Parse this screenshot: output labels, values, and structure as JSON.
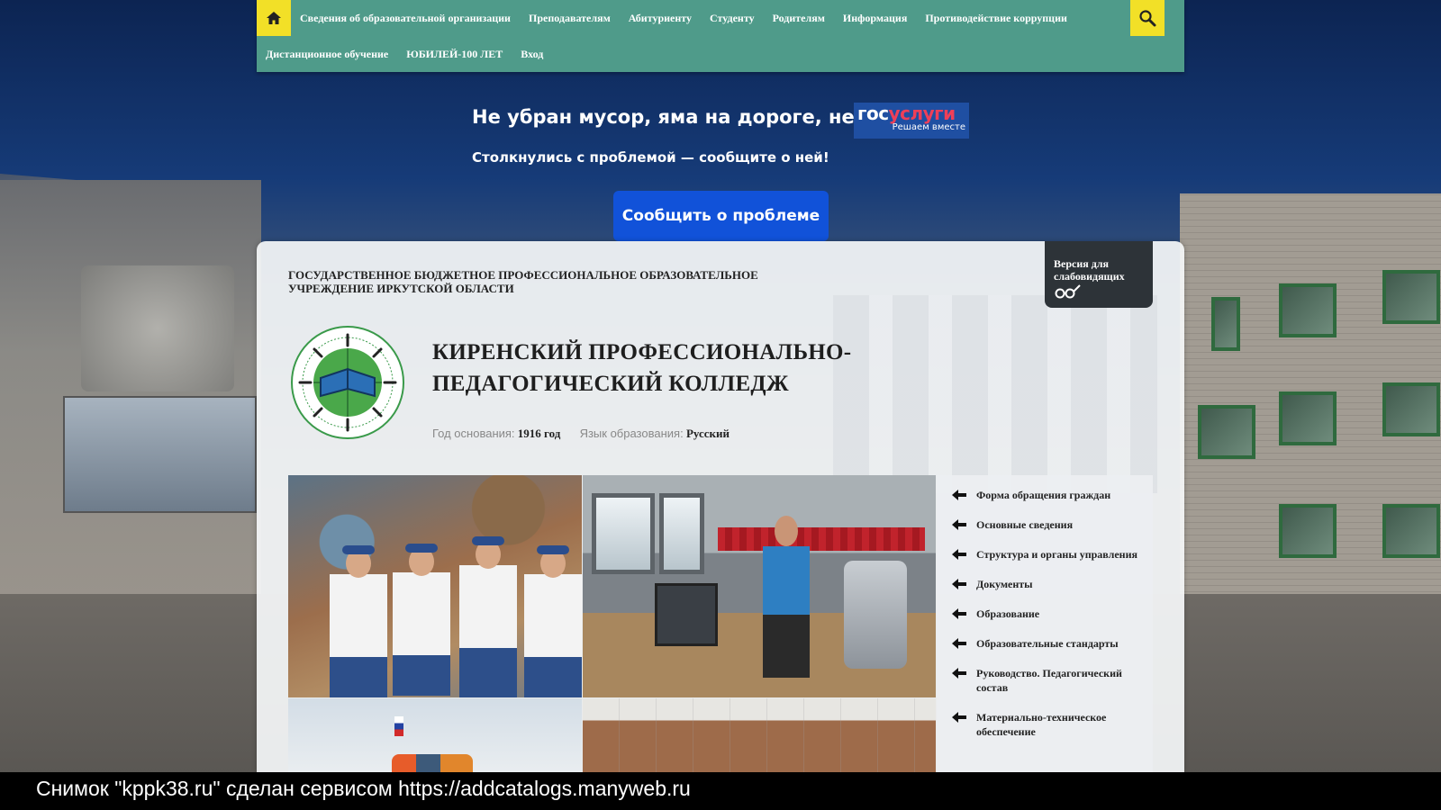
{
  "nav": {
    "home_icon": "home-icon",
    "search_icon": "search-icon",
    "row1": [
      "Сведения об образовательной организации",
      "Преподавателям",
      "Абитуриенту",
      "Студенту",
      "Родителям",
      "Информация",
      "Противодействие коррупции"
    ],
    "row2": [
      "Дистанционное обучение",
      "ЮБИЛЕЙ-100 ЛЕТ",
      "Вход"
    ]
  },
  "gosuslugi": {
    "title": "Не убран мусор, яма на дороге, не гор",
    "logo_part1": "гос",
    "logo_part2": "услуги",
    "logo_sub": "Решаем вместе",
    "subtitle": "Столкнулись с проблемой — сообщите о ней!",
    "button": "Сообщить о проблеме"
  },
  "header": {
    "org_type": "ГОСУДАРСТВЕННОЕ БЮДЖЕТНОЕ ПРОФЕССИОНАЛЬНОЕ ОБРАЗОВАТЕЛЬНОЕ УЧРЕЖДЕНИЕ ИРКУТСКОЙ ОБЛАСТИ",
    "vision_label": "Версия для слабовидящих",
    "vision_icon": "glasses-icon",
    "college_name": "КИРЕНСКИЙ ПРОФЕССИОНАЛЬНО-ПЕДАГОГИЧЕСКИЙ КОЛЛЕДЖ",
    "founded_label": "Год основания:",
    "founded_value": "1916 год",
    "language_label": "Язык образования:",
    "language_value": "Русский"
  },
  "side_menu": [
    "Форма обращения граждан",
    "Основные сведения",
    "Структура и органы управления",
    "Документы",
    "Образование",
    "Образовательные стандарты",
    "Руководство. Педагогический состав",
    "Материально-техническое обеспечение"
  ],
  "caption": "Снимок \"kppk38.ru\" сделан сервисом https://addcatalogs.manyweb.ru",
  "colors": {
    "nav_bg": "#4f9b8a",
    "nav_accent": "#f2e027",
    "gos_button": "#1152d9",
    "gos_logo_bg": "#1f4fa2",
    "gos_logo_red": "#ee3f58"
  }
}
